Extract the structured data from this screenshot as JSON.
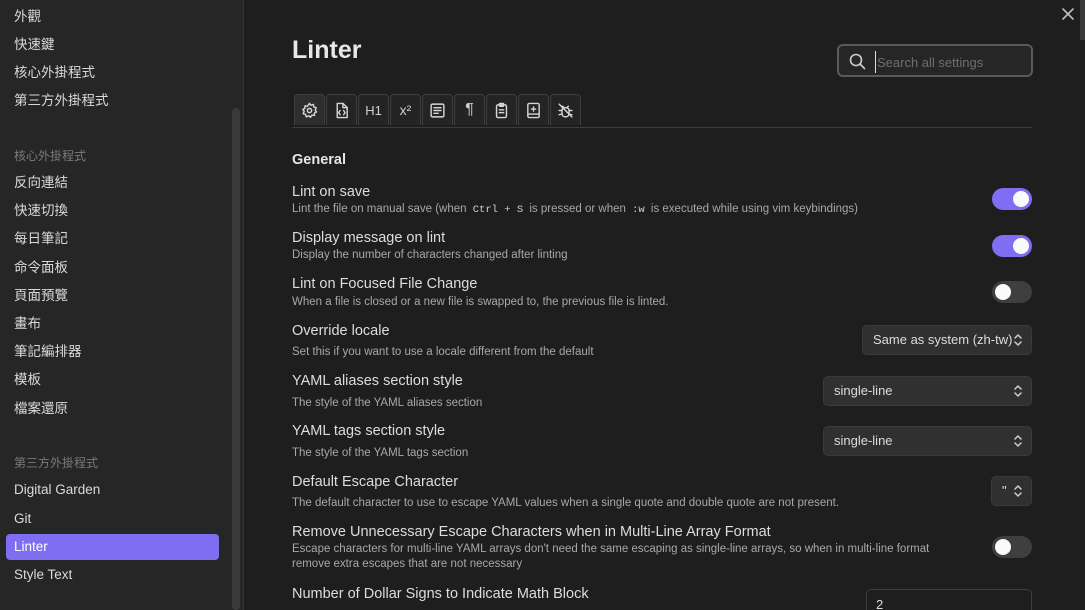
{
  "window": {
    "close_icon": "close-icon"
  },
  "sidebar": {
    "top_items": [
      {
        "label": "外觀"
      },
      {
        "label": "快速鍵"
      },
      {
        "label": "核心外掛程式"
      },
      {
        "label": "第三方外掛程式"
      }
    ],
    "core_heading": "核心外掛程式",
    "core_items": [
      {
        "label": "反向連結"
      },
      {
        "label": "快速切換"
      },
      {
        "label": "每日筆記"
      },
      {
        "label": "命令面板"
      },
      {
        "label": "頁面預覽"
      },
      {
        "label": "畫布"
      },
      {
        "label": "筆記編排器"
      },
      {
        "label": "模板"
      },
      {
        "label": "檔案還原"
      }
    ],
    "community_heading": "第三方外掛程式",
    "community_items": [
      {
        "label": "Digital Garden",
        "active": false
      },
      {
        "label": "Git",
        "active": false
      },
      {
        "label": "Linter",
        "active": true
      },
      {
        "label": "Style Text",
        "active": false
      }
    ]
  },
  "main": {
    "title": "Linter",
    "search": {
      "placeholder": "Search all settings",
      "value": "",
      "icon": "search-icon"
    },
    "tabs": [
      {
        "icon": "gear-icon"
      },
      {
        "icon": "file-code-icon"
      },
      {
        "icon": "heading-icon",
        "text": "H1"
      },
      {
        "icon": "superscript-icon",
        "text": "x²"
      },
      {
        "icon": "content-icon"
      },
      {
        "icon": "pilcrow-icon",
        "text": "¶"
      },
      {
        "icon": "clipboard-icon"
      },
      {
        "icon": "book-plus-icon"
      },
      {
        "icon": "bug-off-icon"
      }
    ],
    "section": "General",
    "settings": {
      "lint_on_save": {
        "name": "Lint on save",
        "desc_a": "Lint the file on manual save (when",
        "code_a": "Ctrl + S",
        "desc_b": "is pressed or when",
        "code_b": ":w",
        "desc_c": "is executed while using vim keybindings)",
        "on": true
      },
      "display_message": {
        "name": "Display message on lint",
        "desc": "Display the number of characters changed after linting",
        "on": true
      },
      "focused_file_change": {
        "name": "Lint on Focused File Change",
        "desc": "When a file is closed or a new file is swapped to, the previous file is linted.",
        "on": false
      },
      "override_locale": {
        "name": "Override locale",
        "desc": "Set this if you want to use a locale different from the default",
        "value": "Same as system (zh-tw)"
      },
      "yaml_aliases": {
        "name": "YAML aliases section style",
        "desc": "The style of the YAML aliases section",
        "value": "single-line"
      },
      "yaml_tags": {
        "name": "YAML tags section style",
        "desc": "The style of the YAML tags section",
        "value": "single-line"
      },
      "escape_char": {
        "name": "Default Escape Character",
        "desc": "The default character to use to escape YAML values when a single quote and double quote are not present.",
        "value": "\""
      },
      "remove_escape": {
        "name": "Remove Unnecessary Escape Characters when in Multi-Line Array Format",
        "desc": "Escape characters for multi-line YAML arrays don't need the same escaping as single-line arrays, so when in multi-line format remove extra escapes that are not necessary",
        "on": false
      },
      "dollar_signs": {
        "name": "Number of Dollar Signs to Indicate Math Block",
        "value": "2"
      }
    }
  },
  "colors": {
    "accent": "#7f6df2",
    "background": "#1e1e1e",
    "sidebar": "#262626"
  }
}
